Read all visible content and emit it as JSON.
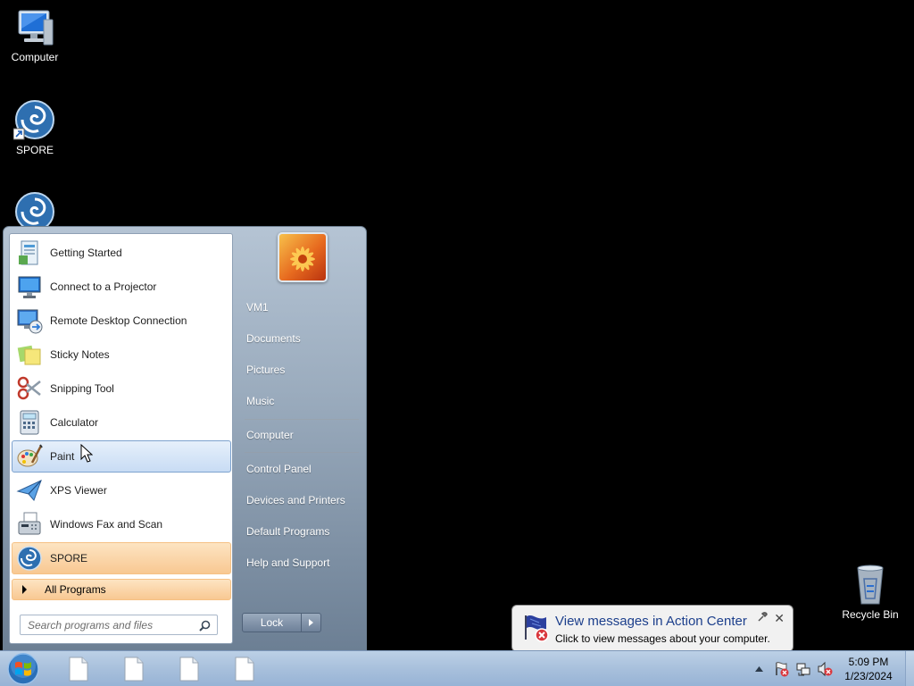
{
  "desktop": {
    "icons": [
      {
        "label": "Computer",
        "icon": "computer-monitor-icon"
      },
      {
        "label": "SPORE",
        "icon": "spore-spiral-icon"
      },
      {
        "label": "",
        "icon": "spore-spiral-icon"
      },
      {
        "label": "Recycle Bin",
        "icon": "recycle-bin-icon"
      }
    ]
  },
  "start_menu": {
    "programs": [
      {
        "label": "Getting Started",
        "icon": "getting-started-icon"
      },
      {
        "label": "Connect to a Projector",
        "icon": "projector-icon"
      },
      {
        "label": "Remote Desktop Connection",
        "icon": "remote-desktop-icon"
      },
      {
        "label": "Sticky Notes",
        "icon": "sticky-notes-icon"
      },
      {
        "label": "Snipping Tool",
        "icon": "scissors-icon"
      },
      {
        "label": "Calculator",
        "icon": "calculator-icon"
      },
      {
        "label": "Paint",
        "icon": "paint-palette-icon"
      },
      {
        "label": "XPS Viewer",
        "icon": "xps-viewer-icon"
      },
      {
        "label": "Windows Fax and Scan",
        "icon": "fax-icon"
      },
      {
        "label": "SPORE",
        "icon": "spore-spiral-icon"
      }
    ],
    "hovered_program": "Paint",
    "all_programs_label": "All Programs",
    "search_placeholder": "Search programs and files",
    "right_items": [
      {
        "label": "VM1"
      },
      {
        "label": "Documents"
      },
      {
        "label": "Pictures"
      },
      {
        "label": "Music"
      },
      {
        "label": "Computer"
      },
      {
        "label": "Control Panel"
      },
      {
        "label": "Devices and Printers"
      },
      {
        "label": "Default Programs"
      },
      {
        "label": "Help and Support"
      }
    ],
    "lock_label": "Lock"
  },
  "taskbar": {
    "pinned": [
      {
        "icon": "blank-document-icon"
      },
      {
        "icon": "blank-document-icon"
      },
      {
        "icon": "blank-document-icon"
      },
      {
        "icon": "blank-document-icon"
      }
    ],
    "tray_icons": [
      "show-hidden-icons-arrow",
      "action-center-flag-error-icon",
      "network-icon",
      "volume-muted-icon"
    ],
    "clock_time": "5:09 PM",
    "clock_date": "1/23/2024"
  },
  "notification": {
    "title": "View messages in Action Center",
    "body": "Click to view messages about your computer.",
    "close_glyph": "✕"
  }
}
